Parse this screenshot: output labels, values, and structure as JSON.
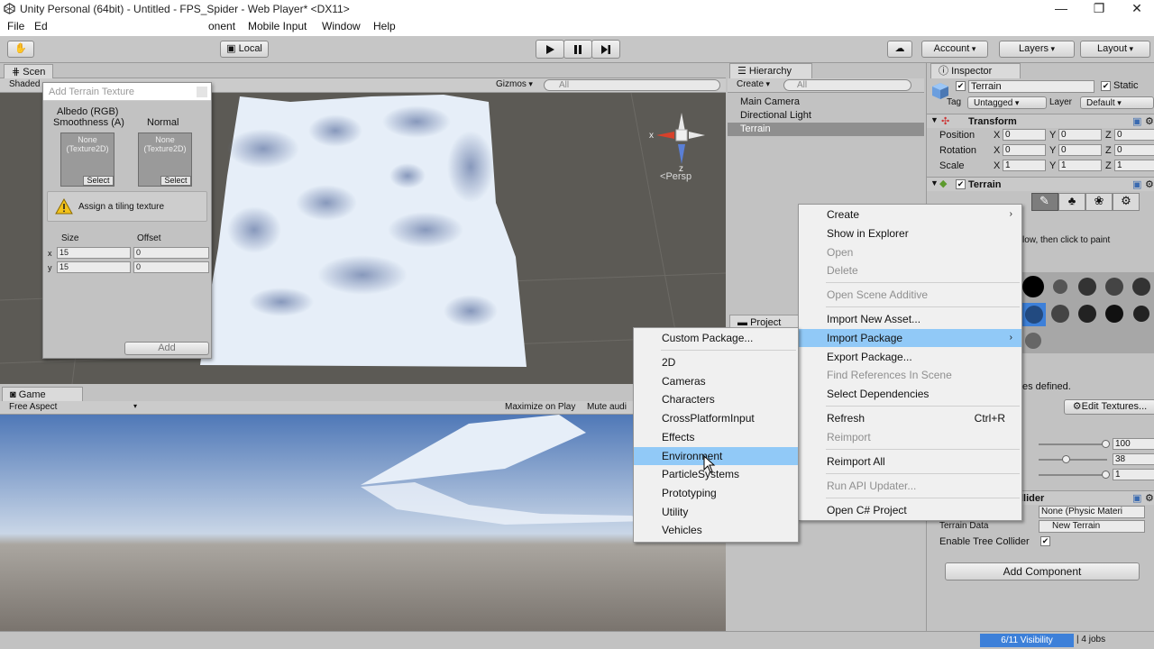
{
  "window": {
    "title": "Unity Personal (64bit) - Untitled - FPS_Spider - Web Player* <DX11>",
    "min": "—",
    "max": "❐",
    "close": "✕"
  },
  "menubar": [
    "File",
    "Ed",
    "onent",
    "Mobile Input",
    "Window",
    "Help"
  ],
  "toolbar": {
    "local": "Local",
    "account": "Account",
    "layers": "Layers",
    "layout": "Layout"
  },
  "scene": {
    "tab": "Scen",
    "shaded": "Shaded",
    "gizmos": "Gizmos",
    "search_placeholder": "All",
    "persp": "Persp",
    "axis_x": "x",
    "axis_z": "z"
  },
  "dialog": {
    "title": "Add Terrain Texture",
    "albedo": "Albedo (RGB)",
    "smoothness": "Smoothness (A)",
    "normal": "Normal",
    "slot_none": "None",
    "slot_type": "(Texture2D)",
    "select": "Select",
    "warning": "Assign a tiling texture",
    "size": "Size",
    "offset": "Offset",
    "x": "x",
    "y": "y",
    "size_x": "15",
    "size_y": "15",
    "offset_x": "0",
    "offset_y": "0",
    "add": "Add"
  },
  "game": {
    "tab": "Game",
    "aspect": "Free Aspect",
    "maximize": "Maximize on Play",
    "mute": "Mute audi"
  },
  "hierarchy": {
    "tab": "Hierarchy",
    "create": "Create",
    "search_placeholder": "All",
    "items": [
      "Main Camera",
      "Directional Light",
      "Terrain"
    ]
  },
  "project": {
    "tab": "Project"
  },
  "inspector": {
    "tab": "Inspector",
    "name": "Terrain",
    "static": "Static",
    "tag_label": "Tag",
    "tag": "Untagged",
    "layer_label": "Layer",
    "layer": "Default",
    "transform": "Transform",
    "position": "Position",
    "rotation": "Rotation",
    "scale": "Scale",
    "pos": [
      "0",
      "0",
      "0"
    ],
    "rot": [
      "0",
      "0",
      "0"
    ],
    "scl": [
      "1",
      "1",
      "1"
    ],
    "X": "X",
    "Y": "Y",
    "Z": "Z",
    "terrain_comp": "Terrain",
    "hint": "low, then click to paint",
    "textures_defined": "es defined.",
    "edit_textures": "Edit Textures...",
    "slider1": "100",
    "slider2": "38",
    "slider3": "1",
    "collider": "llider",
    "material": "None (Physic Materi",
    "terrain_data_label": "Terrain Data",
    "terrain_data": "New Terrain",
    "enable_tree": "Enable Tree Collider",
    "add_component": "Add Component"
  },
  "context_menu": [
    {
      "label": "Create",
      "arrow": true
    },
    {
      "label": "Show in Explorer"
    },
    {
      "label": "Open",
      "disabled": true
    },
    {
      "label": "Delete",
      "disabled": true
    },
    {
      "label": "Open Scene Additive",
      "disabled": true
    },
    {
      "label": "Import New Asset..."
    },
    {
      "label": "Import Package",
      "arrow": true,
      "highlight": true
    },
    {
      "label": "Export Package..."
    },
    {
      "label": "Find References In Scene",
      "disabled": true
    },
    {
      "label": "Select Dependencies"
    },
    {
      "label": "Refresh",
      "shortcut": "Ctrl+R"
    },
    {
      "label": "Reimport",
      "disabled": true
    },
    {
      "label": "Reimport All"
    },
    {
      "label": "Run API Updater...",
      "disabled": true
    },
    {
      "label": "Open C# Project"
    }
  ],
  "submenu": [
    "Custom Package...",
    "2D",
    "Cameras",
    "Characters",
    "CrossPlatformInput",
    "Effects",
    "Environment",
    "ParticleSystems",
    "Prototyping",
    "Utility",
    "Vehicles"
  ],
  "status": {
    "visibility": "6/11 Visibility",
    "jobs": "4 jobs"
  },
  "colors": {
    "menu_highlight": "#91c9f7",
    "selection": "#3d80d9",
    "panel": "#c2c2c2"
  }
}
